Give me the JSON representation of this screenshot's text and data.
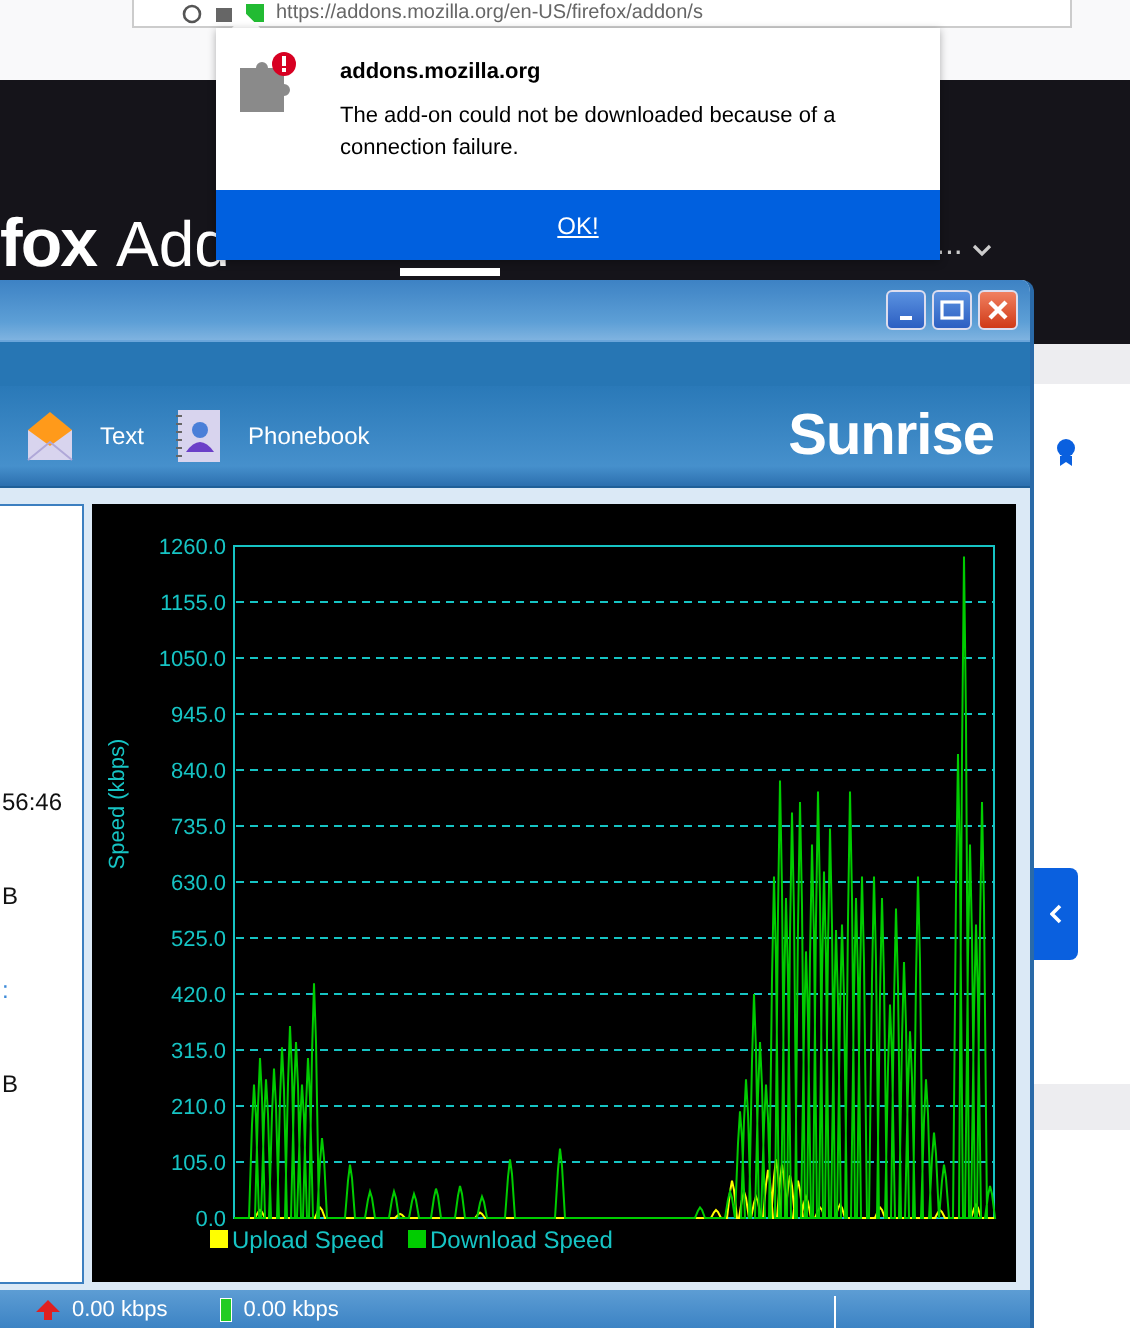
{
  "browser": {
    "url": "https://addons.mozilla.org/en-US/firefox/addon/s"
  },
  "site_header": {
    "brand": "fox",
    "title": "Add",
    "more": "..."
  },
  "notification": {
    "host": "addons.mozilla.org",
    "message": "The add-on could not be downloaded because of a connection failure.",
    "button": "OK!"
  },
  "app_window": {
    "toolbar": [
      {
        "kind": "text",
        "label": "Text"
      },
      {
        "kind": "phonebook",
        "label": "Phonebook"
      }
    ],
    "brand": "Sunrise",
    "info": [
      {
        "kind": "value",
        "text": "56:46"
      },
      {
        "kind": "value",
        "text": "B"
      },
      {
        "kind": "link",
        "text": ":"
      },
      {
        "kind": "value",
        "text": "B"
      }
    ],
    "chart": {
      "ylabel": "Speed (kbps)",
      "yticks": [
        "1260.0",
        "1155.0",
        "1050.0",
        "945.0",
        "840.0",
        "735.0",
        "630.0",
        "525.0",
        "420.0",
        "315.0",
        "210.0",
        "105.0",
        "0.0"
      ],
      "legend": [
        {
          "kind": "upload",
          "name": "Upload Speed",
          "color": "#ffff00"
        },
        {
          "kind": "download",
          "name": "Download Speed",
          "color": "#00cc00"
        }
      ]
    },
    "status_bar": [
      {
        "kind": "upload",
        "text": "0.00 kbps"
      },
      {
        "kind": "download",
        "text": "0.00 kbps"
      }
    ]
  }
}
